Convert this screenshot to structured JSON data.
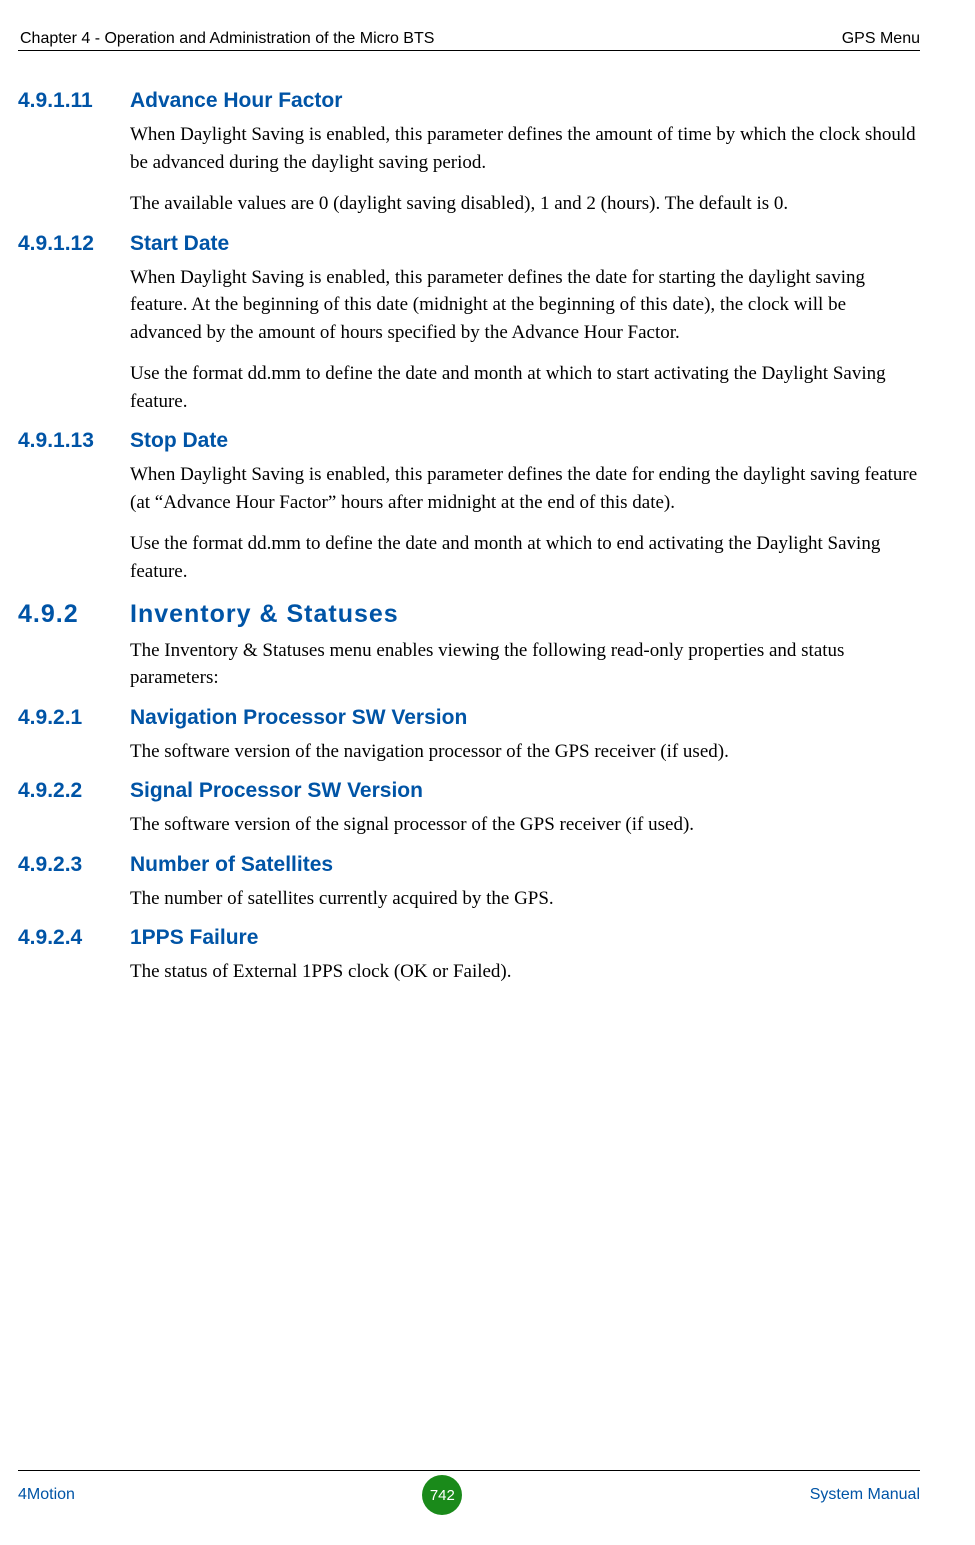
{
  "header": {
    "left": "Chapter 4 - Operation and Administration of the Micro BTS",
    "right": "GPS Menu"
  },
  "sections": [
    {
      "num": "4.9.1.11",
      "title": "Advance Hour Factor",
      "level": "h3",
      "paras": [
        "When Daylight Saving is enabled, this parameter defines the amount of time by which the clock should be advanced during the daylight saving period.",
        "The available values are 0 (daylight saving disabled), 1 and 2 (hours). The default is 0."
      ]
    },
    {
      "num": "4.9.1.12",
      "title": "Start Date",
      "level": "h3",
      "paras": [
        "When Daylight Saving is enabled, this parameter defines the date for starting the daylight saving feature. At the beginning of this date (midnight at the beginning of this date), the clock will be advanced by the amount of hours specified by the Advance Hour Factor.",
        "Use the format dd.mm to define the date and month at which to start activating the Daylight Saving feature."
      ]
    },
    {
      "num": "4.9.1.13",
      "title": "Stop Date",
      "level": "h3",
      "paras": [
        "When Daylight Saving is enabled, this parameter defines the date for ending the daylight saving feature (at “Advance Hour Factor” hours after midnight at the end of this date).",
        "Use the format dd.mm to define the date and month at which to end activating the Daylight Saving feature."
      ]
    },
    {
      "num": "4.9.2",
      "title": "Inventory & Statuses",
      "level": "h2",
      "paras": [
        "The Inventory & Statuses menu enables viewing the following read-only properties and status parameters:"
      ]
    },
    {
      "num": "4.9.2.1",
      "title": "Navigation Processor SW Version",
      "level": "h3",
      "paras": [
        "The software version of the navigation processor of the GPS receiver (if used)."
      ]
    },
    {
      "num": "4.9.2.2",
      "title": "Signal Processor SW Version",
      "level": "h3",
      "paras": [
        "The software version of the signal processor of the GPS receiver (if used)."
      ]
    },
    {
      "num": "4.9.2.3",
      "title": "Number of Satellites",
      "level": "h3",
      "paras": [
        "The number of satellites currently acquired by the GPS."
      ]
    },
    {
      "num": "4.9.2.4",
      "title": "1PPS Failure",
      "level": "h3",
      "paras": [
        "The status of External 1PPS clock (OK or Failed)."
      ]
    }
  ],
  "footer": {
    "left": "4Motion",
    "page": "742",
    "right": "System Manual"
  }
}
